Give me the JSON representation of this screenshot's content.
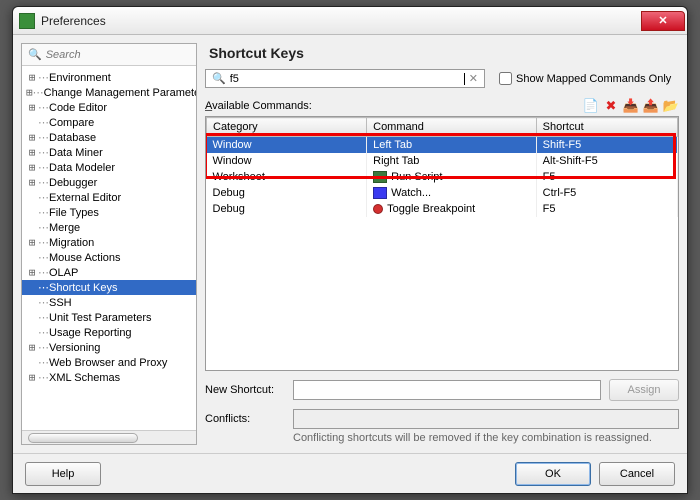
{
  "window": {
    "title": "Preferences",
    "close": "✕"
  },
  "sidebar": {
    "search_placeholder": "Search",
    "items": [
      {
        "label": "Environment",
        "expandable": true
      },
      {
        "label": "Change Management Parameters",
        "expandable": true
      },
      {
        "label": "Code Editor",
        "expandable": true
      },
      {
        "label": "Compare",
        "expandable": false
      },
      {
        "label": "Database",
        "expandable": true
      },
      {
        "label": "Data Miner",
        "expandable": true
      },
      {
        "label": "Data Modeler",
        "expandable": true
      },
      {
        "label": "Debugger",
        "expandable": true
      },
      {
        "label": "External Editor",
        "expandable": false
      },
      {
        "label": "File Types",
        "expandable": false
      },
      {
        "label": "Merge",
        "expandable": false
      },
      {
        "label": "Migration",
        "expandable": true
      },
      {
        "label": "Mouse Actions",
        "expandable": false
      },
      {
        "label": "OLAP",
        "expandable": true
      },
      {
        "label": "Shortcut Keys",
        "expandable": false,
        "selected": true
      },
      {
        "label": "SSH",
        "expandable": false
      },
      {
        "label": "Unit Test Parameters",
        "expandable": false
      },
      {
        "label": "Usage Reporting",
        "expandable": false
      },
      {
        "label": "Versioning",
        "expandable": true
      },
      {
        "label": "Web Browser and Proxy",
        "expandable": false
      },
      {
        "label": "XML Schemas",
        "expandable": true
      }
    ]
  },
  "panel": {
    "heading": "Shortcut Keys",
    "filter_value": "f5",
    "show_mapped_label": "Show Mapped Commands Only",
    "available_label": "Available Commands:",
    "columns": {
      "category": "Category",
      "command": "Command",
      "shortcut": "Shortcut"
    },
    "rows": [
      {
        "category": "Window",
        "command": "Left Tab",
        "shortcut": "Shift-F5",
        "selected": true,
        "icon": ""
      },
      {
        "category": "Window",
        "command": "Right Tab",
        "shortcut": "Alt-Shift-F5",
        "selected": false,
        "icon": ""
      },
      {
        "category": "Worksheet",
        "command": "Run Script",
        "shortcut": "F5",
        "selected": false,
        "icon": "run"
      },
      {
        "category": "Debug",
        "command": "Watch...",
        "shortcut": "Ctrl-F5",
        "selected": false,
        "icon": "watch"
      },
      {
        "category": "Debug",
        "command": "Toggle Breakpoint",
        "shortcut": "F5",
        "selected": false,
        "icon": "bp"
      }
    ],
    "new_shortcut_label": "New Shortcut:",
    "conflicts_label": "Conflicts:",
    "assign_label": "Assign",
    "hint": "Conflicting shortcuts will be removed if the key combination is reassigned."
  },
  "footer": {
    "help": "Help",
    "ok": "OK",
    "cancel": "Cancel"
  },
  "icons": {
    "copy": "📄",
    "delete": "✖",
    "import": "📥",
    "export": "📤",
    "folder": "📂",
    "mag": "🔍"
  }
}
